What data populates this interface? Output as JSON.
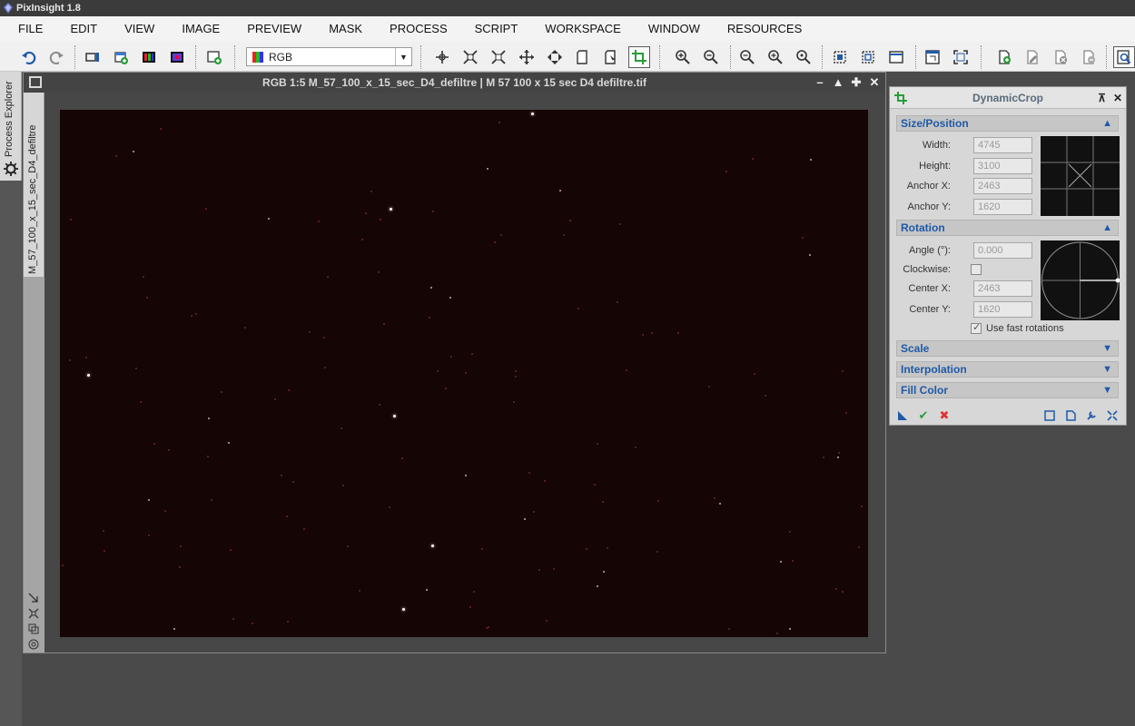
{
  "app": {
    "title": "PixInsight 1.8"
  },
  "menu": [
    "FILE",
    "EDIT",
    "VIEW",
    "IMAGE",
    "PREVIEW",
    "MASK",
    "PROCESS",
    "SCRIPT",
    "WORKSPACE",
    "WINDOW",
    "RESOURCES"
  ],
  "toolbar": {
    "channel_select": "RGB"
  },
  "side_tab": {
    "process_explorer": "Process Explorer"
  },
  "image_window": {
    "title": "RGB 1:5 M_57_100_x_15_sec_D4_defiltre | M 57 100 x 15 sec D4 defiltre.tif",
    "view_tab": "M_57_100_x_15_sec_D4_defiltre"
  },
  "dynamic_crop": {
    "title": "DynamicCrop",
    "size_position": {
      "header": "Size/Position",
      "width_label": "Width:",
      "width": "4745",
      "height_label": "Height:",
      "height": "3100",
      "anchor_x_label": "Anchor X:",
      "anchor_x": "2463",
      "anchor_y_label": "Anchor Y:",
      "anchor_y": "1620"
    },
    "rotation": {
      "header": "Rotation",
      "angle_label": "Angle (°):",
      "angle": "0.000",
      "clockwise_label": "Clockwise:",
      "center_x_label": "Center X:",
      "center_x": "2463",
      "center_y_label": "Center Y:",
      "center_y": "1620",
      "fast_rotations_label": "Use fast rotations"
    },
    "collapsed_sections": [
      "Scale",
      "Interpolation",
      "Fill Color"
    ]
  },
  "colors": {
    "accent": "#1f5aa8",
    "image_background": "#150504",
    "workspace": "#4a4a4a"
  }
}
